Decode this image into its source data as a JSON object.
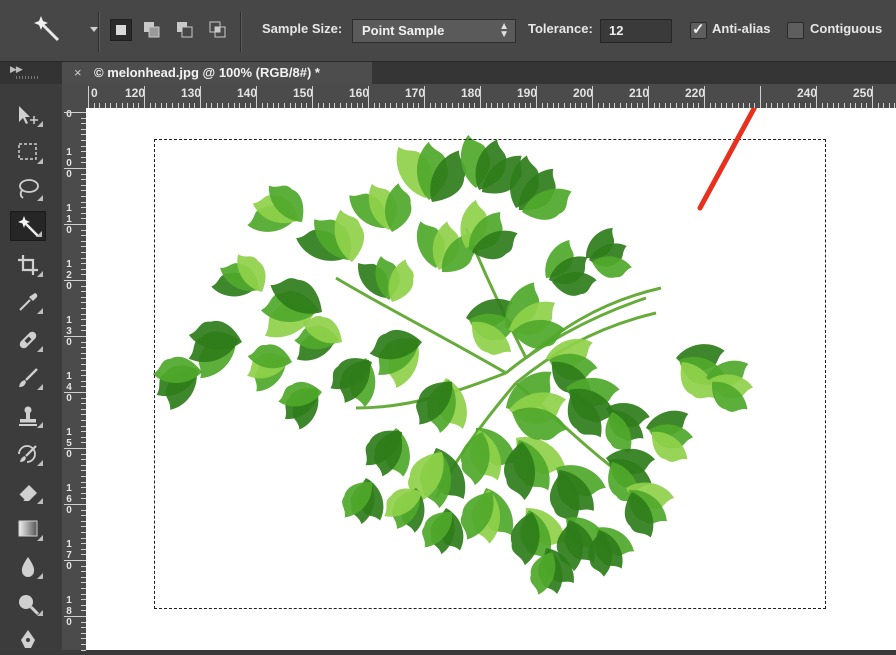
{
  "options_bar": {
    "sample_size_label": "Sample Size:",
    "sample_size_value": "Point Sample",
    "tolerance_label": "Tolerance:",
    "tolerance_value": "12",
    "anti_alias_label": "Anti-alias",
    "anti_alias_checked": true,
    "contiguous_label": "Contiguous",
    "contiguous_checked": false
  },
  "document": {
    "close_glyph": "×",
    "tab_title": "© melonhead.jpg @ 100% (RGB/8#) *"
  },
  "ruler_h": [
    "0",
    "120",
    "130",
    "140",
    "150",
    "160",
    "170",
    "180",
    "190",
    "200",
    "210",
    "220",
    "240",
    "250"
  ],
  "ruler_v": [
    {
      "digits": [
        "1",
        "0",
        "0"
      ]
    },
    {
      "digits": [
        "1",
        "1",
        "0"
      ]
    },
    {
      "digits": [
        "1",
        "2",
        "0"
      ]
    },
    {
      "digits": [
        "1",
        "3",
        "0"
      ]
    },
    {
      "digits": [
        "1",
        "4",
        "0"
      ]
    },
    {
      "digits": [
        "1",
        "5",
        "0"
      ]
    },
    {
      "digits": [
        "1",
        "6",
        "0"
      ]
    },
    {
      "digits": [
        "1",
        "7",
        "0"
      ]
    },
    {
      "digits": [
        "1",
        "8",
        "0"
      ]
    }
  ],
  "tools": [
    {
      "name": "move-tool",
      "icon": "move-icon"
    },
    {
      "name": "rectangular-marquee-tool",
      "icon": "marquee-icon"
    },
    {
      "name": "lasso-tool",
      "icon": "lasso-icon"
    },
    {
      "name": "magic-wand-tool",
      "icon": "magic-wand-icon",
      "selected": true
    },
    {
      "name": "crop-tool",
      "icon": "crop-icon"
    },
    {
      "name": "eyedropper-tool",
      "icon": "eyedropper-icon"
    },
    {
      "name": "healing-brush-tool",
      "icon": "bandage-icon"
    },
    {
      "name": "brush-tool",
      "icon": "brush-icon"
    },
    {
      "name": "clone-stamp-tool",
      "icon": "stamp-icon"
    },
    {
      "name": "history-brush-tool",
      "icon": "history-brush-icon"
    },
    {
      "name": "eraser-tool",
      "icon": "eraser-icon"
    },
    {
      "name": "gradient-tool",
      "icon": "gradient-icon"
    },
    {
      "name": "blur-tool",
      "icon": "drop-icon"
    },
    {
      "name": "dodge-tool",
      "icon": "dodge-icon"
    },
    {
      "name": "pen-tool",
      "icon": "pen-icon"
    }
  ],
  "colors": {
    "annotation_arrow": "#e8301e",
    "herb_dark": "#2f7d1a",
    "herb_mid": "#4fa82a",
    "herb_light": "#8fd04a"
  }
}
